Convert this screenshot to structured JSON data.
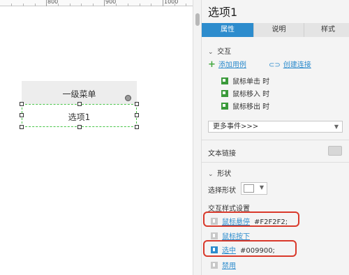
{
  "ruler": {
    "labels": [
      "800",
      "900",
      "1000"
    ]
  },
  "canvas": {
    "menu_label": "一级菜单",
    "option_label": "选项1"
  },
  "panel": {
    "title": "选项1",
    "tabs": [
      {
        "label": "属性",
        "active": true
      },
      {
        "label": "说明",
        "active": false
      },
      {
        "label": "样式",
        "active": false
      }
    ],
    "interaction": {
      "header": "交互",
      "add_case": "添加用例",
      "create_link": "创建连接",
      "events": [
        "鼠标单击 时",
        "鼠标移入 时",
        "鼠标移出 时"
      ],
      "more_events": "更多事件>>>"
    },
    "text_link": {
      "label": "文本链接"
    },
    "shape": {
      "header": "形状",
      "select_label": "选择形状"
    },
    "interaction_styles": {
      "header": "交互样式设置",
      "items": [
        {
          "label": "鼠标悬停",
          "value": "#F2F2F2;",
          "highlighted": true
        },
        {
          "label": "鼠标按下",
          "value": "",
          "highlighted": false
        },
        {
          "label": "选中",
          "value": "#009900;",
          "highlighted": true
        },
        {
          "label": "禁用",
          "value": "",
          "highlighted": false
        }
      ]
    }
  },
  "colors": {
    "accent": "#2d8ccd",
    "highlight_border": "#d9392b",
    "selection_border": "#47c447",
    "event_icon": "#3a9a3a"
  }
}
